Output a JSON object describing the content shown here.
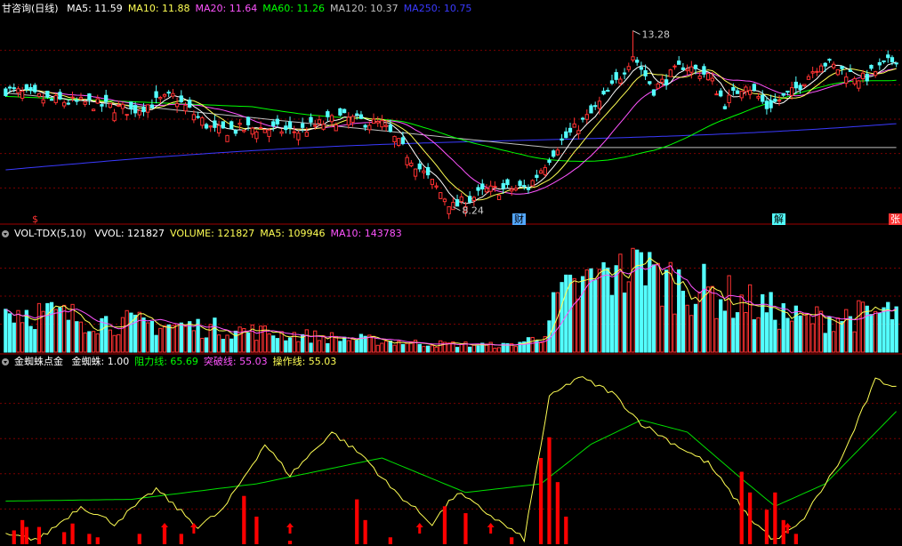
{
  "colors": {
    "up": "#ff3232",
    "down": "#54ffff",
    "ma5": "#ffffff",
    "ma10": "#ffff54",
    "ma20": "#ff54ff",
    "ma60": "#00ff00",
    "ma120": "#c0c0c0",
    "ma250": "#3a3aff",
    "grid": "#7a0000",
    "spider": "#ff0000"
  },
  "main_panel": {
    "title": "甘咨询(日线)",
    "indicators": [
      {
        "label": "MA5: 11.59",
        "color": "#ffffff"
      },
      {
        "label": "MA10: 11.88",
        "color": "#ffff54"
      },
      {
        "label": "MA20: 11.64",
        "color": "#ff54ff"
      },
      {
        "label": "MA60: 11.26",
        "color": "#00ff00"
      },
      {
        "label": "MA120: 10.37",
        "color": "#c0c0c0"
      },
      {
        "label": "MA250: 10.75",
        "color": "#3a3aff"
      }
    ],
    "high_label": "13.28",
    "low_label": "8.24",
    "markers": [
      {
        "text": "$",
        "color": "#ff3232",
        "bg": "transparent"
      },
      {
        "text": "财",
        "color": "#000000",
        "bg": "#54a8ff"
      },
      {
        "text": "解",
        "color": "#000000",
        "bg": "#54ffff"
      },
      {
        "text": "张",
        "color": "#ffffff",
        "bg": "#ff3232"
      }
    ]
  },
  "volume_panel": {
    "title": "VOL-TDX(5,10)",
    "indicators": [
      {
        "label": "VVOL: 121827",
        "color": "#ffffff"
      },
      {
        "label": "VOLUME: 121827",
        "color": "#ffff54"
      },
      {
        "label": "MA5: 109946",
        "color": "#ffff54"
      },
      {
        "label": "MA10: 143783",
        "color": "#ff54ff"
      }
    ]
  },
  "spider_panel": {
    "title": "金蜘蛛点金",
    "indicators": [
      {
        "label": "金蜘蛛: 1.00",
        "color": "#ffffff"
      },
      {
        "label": "阻力线: 65.69",
        "color": "#00ff00"
      },
      {
        "label": "突破线: 55.03",
        "color": "#ff54ff"
      },
      {
        "label": "操作线: 55.03",
        "color": "#ffff54"
      }
    ]
  },
  "chart_data": [
    {
      "type": "candlestick",
      "title": "甘咨询(日线)",
      "ylim": [
        7.8,
        13.7
      ],
      "anchor_points": [
        [
          0,
          11.6
        ],
        [
          10,
          11.3
        ],
        [
          20,
          11.2
        ],
        [
          30,
          11.0
        ],
        [
          40,
          11.4
        ],
        [
          50,
          10.4
        ],
        [
          60,
          10.5
        ],
        [
          70,
          10.4
        ],
        [
          80,
          10.8
        ],
        [
          90,
          10.6
        ],
        [
          100,
          9.2
        ],
        [
          107,
          8.24
        ],
        [
          115,
          8.7
        ],
        [
          125,
          8.8
        ],
        [
          132,
          10.0
        ],
        [
          140,
          10.9
        ],
        [
          146,
          11.8
        ],
        [
          150,
          12.6
        ],
        [
          155,
          11.6
        ],
        [
          162,
          12.3
        ],
        [
          168,
          12.0
        ],
        [
          172,
          11.2
        ],
        [
          177,
          11.8
        ],
        [
          182,
          11.1
        ],
        [
          188,
          11.5
        ],
        [
          195,
          12.4
        ],
        [
          205,
          11.9
        ],
        [
          213,
          12.5
        ]
      ],
      "high": 13.28,
      "low": 8.24,
      "num_candles": 214,
      "ma": {
        "MA5": 11.59,
        "MA10": 11.88,
        "MA20": 11.64,
        "MA60": 11.26,
        "MA120": 10.37,
        "MA250": 10.75
      }
    },
    {
      "type": "bar",
      "title": "VOL-TDX(5,10)",
      "profile": [
        [
          0,
          100
        ],
        [
          25,
          70
        ],
        [
          50,
          55
        ],
        [
          75,
          35
        ],
        [
          100,
          20
        ],
        [
          120,
          15
        ],
        [
          128,
          35
        ],
        [
          132,
          120
        ],
        [
          146,
          190
        ],
        [
          160,
          160
        ],
        [
          175,
          120
        ],
        [
          190,
          75
        ],
        [
          213,
          90
        ]
      ],
      "VVOL": 121827,
      "VOLUME": 121827,
      "MA5": 109946,
      "MA10": 143783
    },
    {
      "type": "line",
      "title": "金蜘蛛点金",
      "ylim": [
        0,
        100
      ],
      "operation_line": [
        [
          0,
          5
        ],
        [
          8,
          3
        ],
        [
          18,
          22
        ],
        [
          26,
          12
        ],
        [
          36,
          32
        ],
        [
          46,
          10
        ],
        [
          52,
          20
        ],
        [
          62,
          58
        ],
        [
          68,
          40
        ],
        [
          78,
          65
        ],
        [
          86,
          50
        ],
        [
          92,
          33
        ],
        [
          102,
          12
        ],
        [
          108,
          30
        ],
        [
          114,
          20
        ],
        [
          124,
          3
        ],
        [
          130,
          85
        ],
        [
          137,
          97
        ],
        [
          145,
          88
        ],
        [
          152,
          70
        ],
        [
          160,
          58
        ],
        [
          168,
          47
        ],
        [
          178,
          15
        ],
        [
          184,
          2
        ],
        [
          190,
          12
        ],
        [
          200,
          50
        ],
        [
          208,
          95
        ],
        [
          213,
          92
        ]
      ],
      "resistance_line": [
        [
          0,
          25
        ],
        [
          30,
          26
        ],
        [
          60,
          35
        ],
        [
          90,
          50
        ],
        [
          110,
          30
        ],
        [
          128,
          35
        ],
        [
          140,
          58
        ],
        [
          152,
          72
        ],
        [
          163,
          65
        ],
        [
          175,
          40
        ],
        [
          184,
          22
        ],
        [
          196,
          35
        ],
        [
          213,
          77
        ]
      ],
      "spider_bars": [
        [
          2,
          8
        ],
        [
          4,
          14
        ],
        [
          5,
          10
        ],
        [
          8,
          10
        ],
        [
          14,
          7
        ],
        [
          16,
          12
        ],
        [
          20,
          6
        ],
        [
          22,
          4
        ],
        [
          32,
          6
        ],
        [
          38,
          10
        ],
        [
          42,
          6
        ],
        [
          57,
          28
        ],
        [
          60,
          16
        ],
        [
          68,
          2
        ],
        [
          84,
          26
        ],
        [
          86,
          14
        ],
        [
          92,
          4
        ],
        [
          105,
          22
        ],
        [
          110,
          18
        ],
        [
          121,
          4
        ],
        [
          128,
          50
        ],
        [
          130,
          62
        ],
        [
          132,
          36
        ],
        [
          134,
          16
        ],
        [
          176,
          42
        ],
        [
          178,
          30
        ],
        [
          182,
          20
        ],
        [
          184,
          30
        ],
        [
          186,
          14
        ],
        [
          189,
          6
        ]
      ],
      "arrows": [
        38,
        45,
        68,
        99,
        116,
        187
      ],
      "values": {
        "金蜘蛛": 1.0,
        "阻力线": 65.69,
        "突破线": 55.03,
        "操作线": 55.03
      }
    }
  ]
}
